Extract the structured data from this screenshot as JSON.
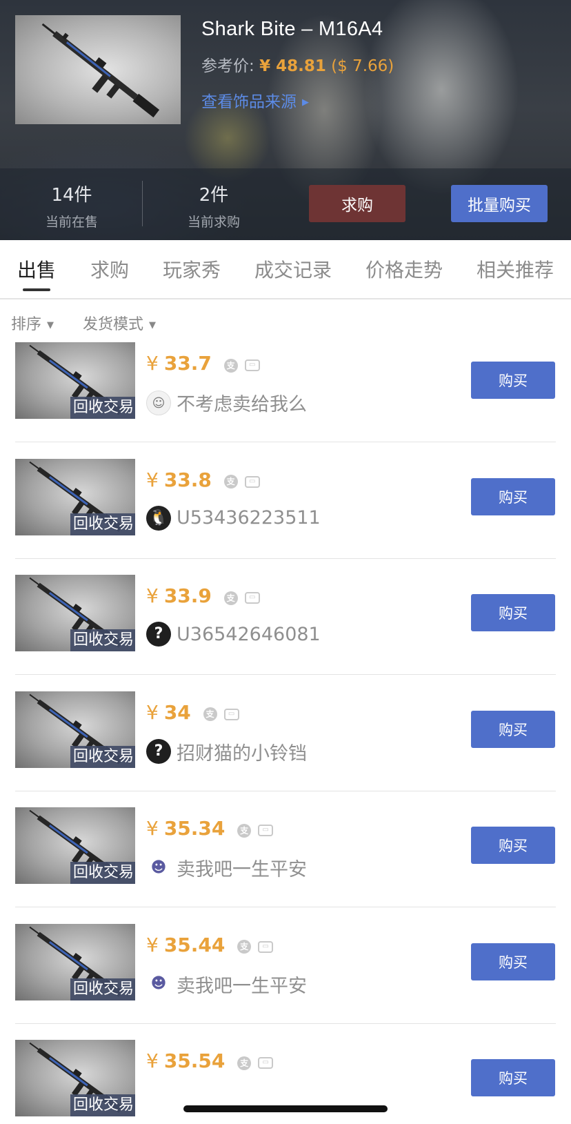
{
  "item": {
    "title": "Shark Bite – M16A4",
    "ref_price_label": "参考价:",
    "ref_price_cny": "¥ 48.81",
    "ref_price_usd": "($ 7.66)",
    "source_link": "查看饰品来源",
    "source_link_arrow": "▶"
  },
  "stats": {
    "on_sale_count": "14件",
    "on_sale_label": "当前在售",
    "wanted_count": "2件",
    "wanted_label": "当前求购",
    "want_button": "求购",
    "bulk_button": "批量购买"
  },
  "tabs": [
    {
      "label": "出售",
      "active": true
    },
    {
      "label": "求购",
      "active": false
    },
    {
      "label": "玩家秀",
      "active": false
    },
    {
      "label": "成交记录",
      "active": false
    },
    {
      "label": "价格走势",
      "active": false
    },
    {
      "label": "相关推荐",
      "active": false
    }
  ],
  "filters": [
    {
      "label": "排序",
      "caret": "▼"
    },
    {
      "label": "发货模式",
      "caret": "▼"
    }
  ],
  "listing_tag": "回收交易",
  "buy_label": "购买",
  "currency_symbol": "¥",
  "pay_icons": [
    "alipay-icon",
    "card-icon"
  ],
  "listings": [
    {
      "price": "33.7",
      "avatar": "face",
      "seller": "不考虑卖给我么"
    },
    {
      "price": "33.8",
      "avatar": "penguin",
      "seller": "U53436223511"
    },
    {
      "price": "33.9",
      "avatar": "question",
      "seller": "U36542646081"
    },
    {
      "price": "34",
      "avatar": "question",
      "seller": "招财猫的小铃铛"
    },
    {
      "price": "35.34",
      "avatar": "cat",
      "seller": "卖我吧一生平安"
    },
    {
      "price": "35.44",
      "avatar": "cat",
      "seller": "卖我吧一生平安"
    },
    {
      "price": "35.54",
      "avatar": "",
      "seller": ""
    }
  ]
}
